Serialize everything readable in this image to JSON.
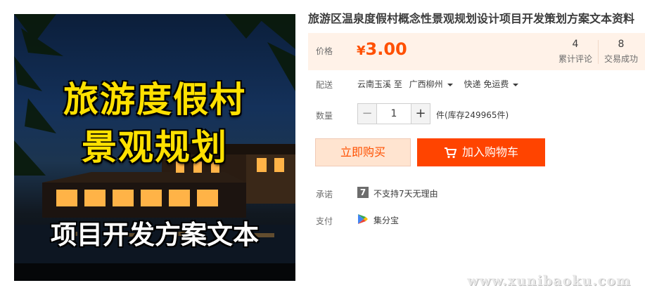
{
  "product": {
    "title": "旅游区温泉度假村概念性景观规划设计项目开发策划方案文本资料",
    "image": {
      "headline_line1": "旅游度假村",
      "headline_line2": "景观规划",
      "subtitle": "项目开发方案文本"
    }
  },
  "price": {
    "label": "价格",
    "currency": "¥",
    "amount": "3.00",
    "reviews": {
      "count": "4",
      "label": "累计评论"
    },
    "sales": {
      "count": "8",
      "label": "交易成功"
    },
    "color": "#ff5000"
  },
  "shipping": {
    "label": "配送",
    "from": "云南玉溪 至",
    "to": "广西柳州",
    "method": "快递 免运费"
  },
  "quantity": {
    "label": "数量",
    "minus": "−",
    "value": "1",
    "plus": "+",
    "stock": "件(库存249965件)"
  },
  "actions": {
    "buy_now": "立即购买",
    "add_to_cart": "加入购物车",
    "accent": "#ff4400"
  },
  "promise": {
    "label": "承诺",
    "icon_text": "7",
    "text": "不支持7天无理由"
  },
  "payment": {
    "label": "支付",
    "method": "集分宝",
    "icon": "play-logo-icon"
  },
  "watermark": "www.xunibaoku.com"
}
